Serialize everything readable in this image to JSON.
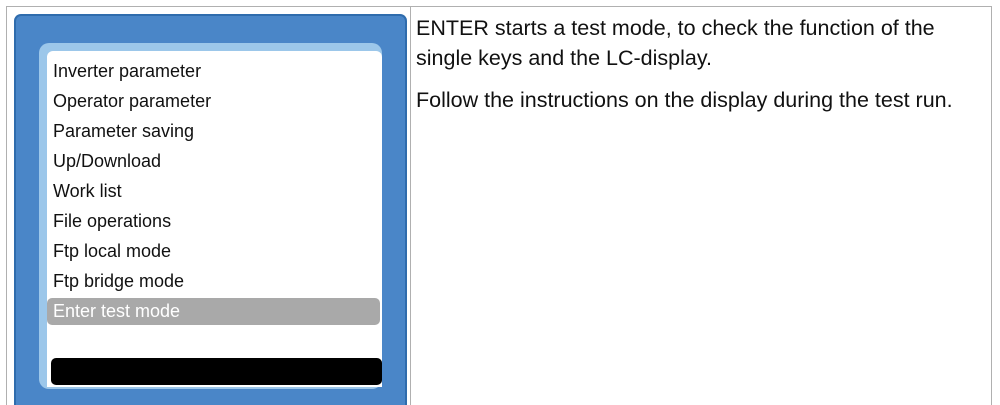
{
  "display": {
    "menu_items": [
      "Inverter parameter",
      "Operator parameter",
      "Parameter saving",
      "Up/Download",
      "Work list",
      "File operations",
      "Ftp local mode",
      "Ftp bridge mode",
      "Enter test mode"
    ],
    "selected_index": 8
  },
  "description": {
    "paragraph_1": "ENTER starts a test mode, to check the function of the single keys and the LC-display.",
    "paragraph_2": "Follow the instructions on the display during the test run."
  },
  "colors": {
    "panel_blue": "#4a86c8",
    "bezel_light_blue": "#9cc7ea",
    "selection_gray": "#a9a9a9",
    "status_bar": "#000000"
  }
}
